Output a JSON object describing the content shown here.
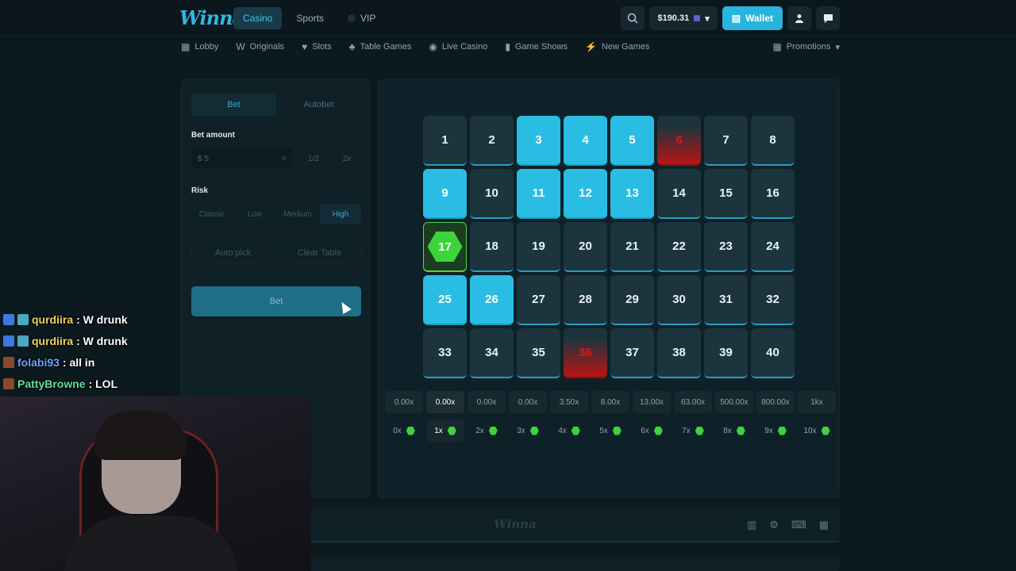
{
  "header": {
    "logo": "Winna",
    "tabs": [
      {
        "label": "Casino"
      },
      {
        "label": "Sports"
      },
      {
        "label": "VIP"
      }
    ],
    "balance": "$190.31",
    "wallet_label": "Wallet"
  },
  "subnav": {
    "items": [
      {
        "label": "Lobby",
        "icon": "grid-icon"
      },
      {
        "label": "Originals",
        "icon": "w-icon"
      },
      {
        "label": "Slots",
        "icon": "heart-icon"
      },
      {
        "label": "Table Games",
        "icon": "chip-icon"
      },
      {
        "label": "Live Casino",
        "icon": "broadcast-icon"
      },
      {
        "label": "Game Shows",
        "icon": "mic-icon"
      },
      {
        "label": "New Games",
        "icon": "bolt-icon"
      }
    ],
    "promotions": "Promotions"
  },
  "panel": {
    "tabs": [
      "Bet",
      "Autobet"
    ],
    "bet_amount_label": "Bet amount",
    "bet_amount_value": "$ 5",
    "half": "1/2",
    "double": "2x",
    "risk_label": "Risk",
    "risk_options": [
      "Classic",
      "Low",
      "Medium",
      "High"
    ],
    "auto_pick": "Auto pick",
    "clear_table": "Clear Table",
    "bet_button": "Bet"
  },
  "game": {
    "tiles": [
      {
        "n": "1",
        "s": "none"
      },
      {
        "n": "2",
        "s": "none"
      },
      {
        "n": "3",
        "s": "sel"
      },
      {
        "n": "4",
        "s": "sel"
      },
      {
        "n": "5",
        "s": "sel"
      },
      {
        "n": "6",
        "s": "miss"
      },
      {
        "n": "7",
        "s": "none"
      },
      {
        "n": "8",
        "s": "none"
      },
      {
        "n": "9",
        "s": "sel"
      },
      {
        "n": "10",
        "s": "none"
      },
      {
        "n": "11",
        "s": "sel"
      },
      {
        "n": "12",
        "s": "sel"
      },
      {
        "n": "13",
        "s": "sel"
      },
      {
        "n": "14",
        "s": "none"
      },
      {
        "n": "15",
        "s": "none"
      },
      {
        "n": "16",
        "s": "none"
      },
      {
        "n": "17",
        "s": "hit"
      },
      {
        "n": "18",
        "s": "none"
      },
      {
        "n": "19",
        "s": "none"
      },
      {
        "n": "20",
        "s": "none"
      },
      {
        "n": "21",
        "s": "none"
      },
      {
        "n": "22",
        "s": "none"
      },
      {
        "n": "23",
        "s": "none"
      },
      {
        "n": "24",
        "s": "none"
      },
      {
        "n": "25",
        "s": "sel"
      },
      {
        "n": "26",
        "s": "sel"
      },
      {
        "n": "27",
        "s": "none"
      },
      {
        "n": "28",
        "s": "none"
      },
      {
        "n": "29",
        "s": "none"
      },
      {
        "n": "30",
        "s": "none"
      },
      {
        "n": "31",
        "s": "none"
      },
      {
        "n": "32",
        "s": "none"
      },
      {
        "n": "33",
        "s": "none"
      },
      {
        "n": "34",
        "s": "none"
      },
      {
        "n": "35",
        "s": "none"
      },
      {
        "n": "36",
        "s": "miss"
      },
      {
        "n": "37",
        "s": "none"
      },
      {
        "n": "38",
        "s": "none"
      },
      {
        "n": "39",
        "s": "none"
      },
      {
        "n": "40",
        "s": "none"
      }
    ],
    "payouts": [
      "0.00x",
      "0.00x",
      "0.00x",
      "0.00x",
      "3.50x",
      "8.00x",
      "13.00x",
      "63.00x",
      "500.00x",
      "800.00x",
      "1kx"
    ],
    "hits": [
      "0x",
      "1x",
      "2x",
      "3x",
      "4x",
      "5x",
      "6x",
      "7x",
      "8x",
      "9x",
      "10x"
    ],
    "active_index": 1
  },
  "footer": {
    "logo": "Winna"
  },
  "chat": [
    {
      "user": "qurdiira",
      "text": " : W drunk",
      "color": "#f2d45c"
    },
    {
      "user": "qurdiira",
      "text": " : W drunk",
      "color": "#f2d45c"
    },
    {
      "user": "folabi93",
      "text": " : all in",
      "color": "#6aa6ff"
    },
    {
      "user": "PattyBrowne",
      "text": " : LOL",
      "color": "#5fe0a0"
    }
  ],
  "colors": {
    "accent": "#29bde4",
    "hit": "#3cd43a",
    "miss": "#d21b1b"
  }
}
